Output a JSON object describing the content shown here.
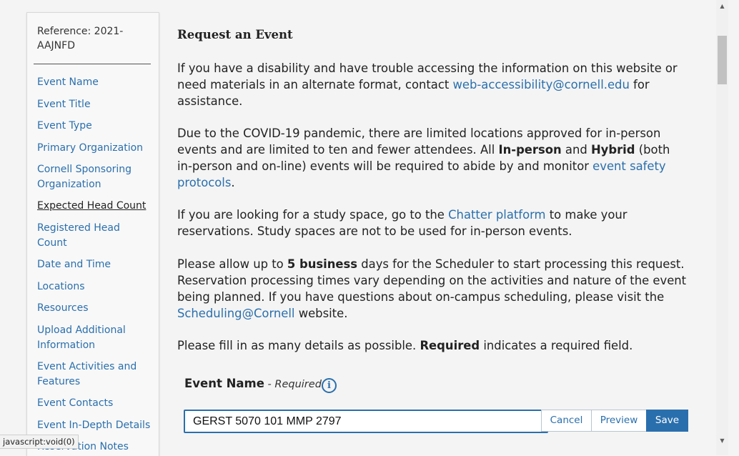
{
  "sidebar": {
    "reference": "Reference: 2021-AAJNFD",
    "items": [
      {
        "label": "Event Name"
      },
      {
        "label": "Event Title"
      },
      {
        "label": "Event Type"
      },
      {
        "label": "Primary Organization"
      },
      {
        "label": "Cornell Sponsoring Organization"
      },
      {
        "label": "Expected Head Count",
        "active": true
      },
      {
        "label": "Registered Head Count"
      },
      {
        "label": "Date and Time"
      },
      {
        "label": "Locations"
      },
      {
        "label": "Resources"
      },
      {
        "label": "Upload Additional Information"
      },
      {
        "label": "Event Activities and Features"
      },
      {
        "label": "Event Contacts"
      },
      {
        "label": "Event In-Depth Details"
      },
      {
        "label": "Reservation Notes"
      }
    ]
  },
  "main": {
    "title": "Request an Event",
    "p1": {
      "before": "If you have a disability and have trouble accessing the information on this website or need materials in an alternate format, contact ",
      "link": "web-accessibility@cornell.edu",
      "after": " for assistance."
    },
    "p2": {
      "t1": "Due to the COVID-19 pandemic, there are limited locations approved for in-person events and are limited to ten and fewer attendees. All ",
      "b1": "In-person",
      "t2": " and ",
      "b2": "Hybrid",
      "t3": " (both in-person and on-line) events will be required to abide by and monitor ",
      "link": "event safety protocols",
      "t4": "."
    },
    "p3": {
      "before": "If you are looking for a study space, go to the ",
      "link": "Chatter platform",
      "after": " to make your reservations. Study spaces are not to be used for in-person events."
    },
    "p4": {
      "t1": "Please allow up to ",
      "b1": "5 business",
      "t2": " days for the Scheduler to start processing this request. Reservation processing times vary depending on the activities and nature of the event being planned. If you have questions about on-campus scheduling, please visit the ",
      "link": "Scheduling@Cornell",
      "t3": " website."
    },
    "p5": {
      "t1": "Please fill in as many details as possible. ",
      "b1": "Required",
      "t2": " indicates a required field."
    },
    "field": {
      "label": "Event Name",
      "required": " - Required",
      "info_icon": "info-icon",
      "value": "GERST 5070 101 MMP 2797"
    },
    "buttons": {
      "cancel": "Cancel",
      "preview": "Preview",
      "save": "Save"
    }
  },
  "statusbar": {
    "text": "javascript:void(0)"
  },
  "colors": {
    "link": "#2a6fad",
    "save_bg": "#2a6fad"
  }
}
